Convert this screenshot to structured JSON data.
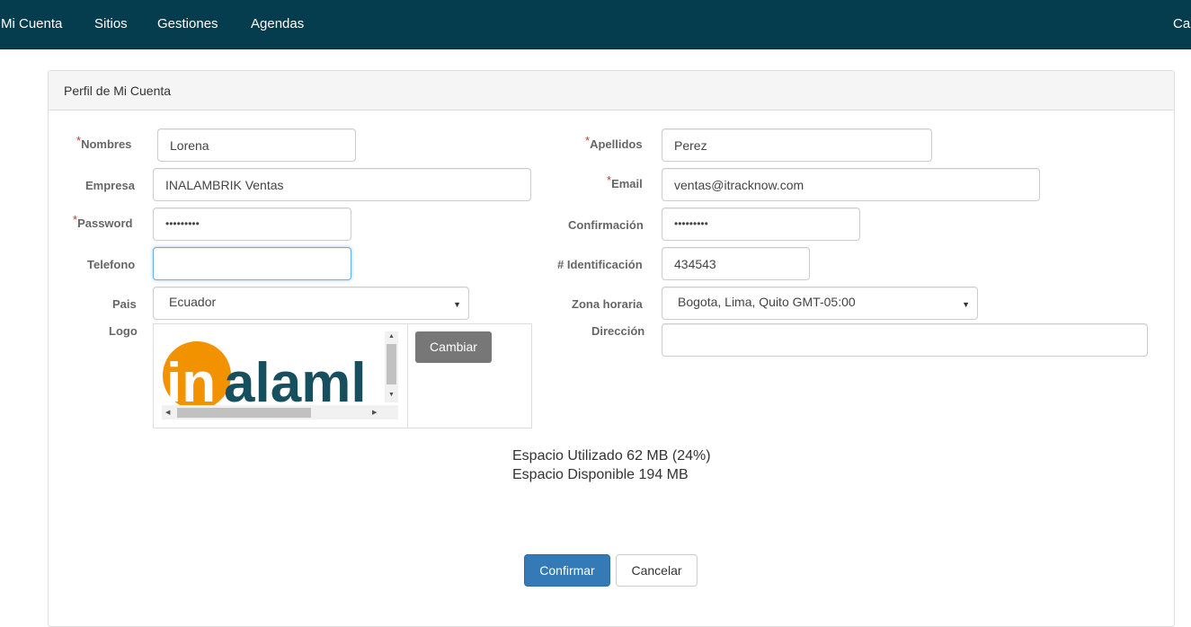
{
  "nav": {
    "items": [
      "Mi Cuenta",
      "Sitios",
      "Gestiones",
      "Agendas"
    ],
    "right_text": "Ca"
  },
  "panel": {
    "title": "Perfil de Mi Cuenta"
  },
  "form": {
    "required_mark": "*",
    "nombres": {
      "label": "Nombres",
      "value": "Lorena"
    },
    "apellidos": {
      "label": "Apellidos",
      "value": "Perez"
    },
    "empresa": {
      "label": "Empresa",
      "value": "INALAMBRIK Ventas"
    },
    "email": {
      "label": "Email",
      "value": "ventas@itracknow.com"
    },
    "password": {
      "label": "Password",
      "value": "•••••••••"
    },
    "confirmacion": {
      "label": "Confirmación",
      "value": "•••••••••"
    },
    "telefono": {
      "label": "Telefono",
      "value": ""
    },
    "identificacion": {
      "label": "# Identificación",
      "value": "434543"
    },
    "pais": {
      "label": "Pais",
      "value": "Ecuador"
    },
    "zona_horaria": {
      "label": "Zona horaria",
      "value": "Bogota, Lima, Quito GMT-05:00"
    },
    "logo": {
      "label": "Logo",
      "image_text": "inalaml",
      "change_button": "Cambiar"
    },
    "direccion": {
      "label": "Dirección",
      "value": ""
    }
  },
  "usage": {
    "used": "Espacio Utilizado 62 MB (24%)",
    "available": "Espacio Disponible 194 MB"
  },
  "actions": {
    "confirm": "Confirmar",
    "cancel": "Cancelar"
  },
  "colors": {
    "navbar": "#063d4e",
    "primary": "#337ab7",
    "logo_orange": "#f39200",
    "logo_teal": "#16505f",
    "required": "#c0392b"
  }
}
